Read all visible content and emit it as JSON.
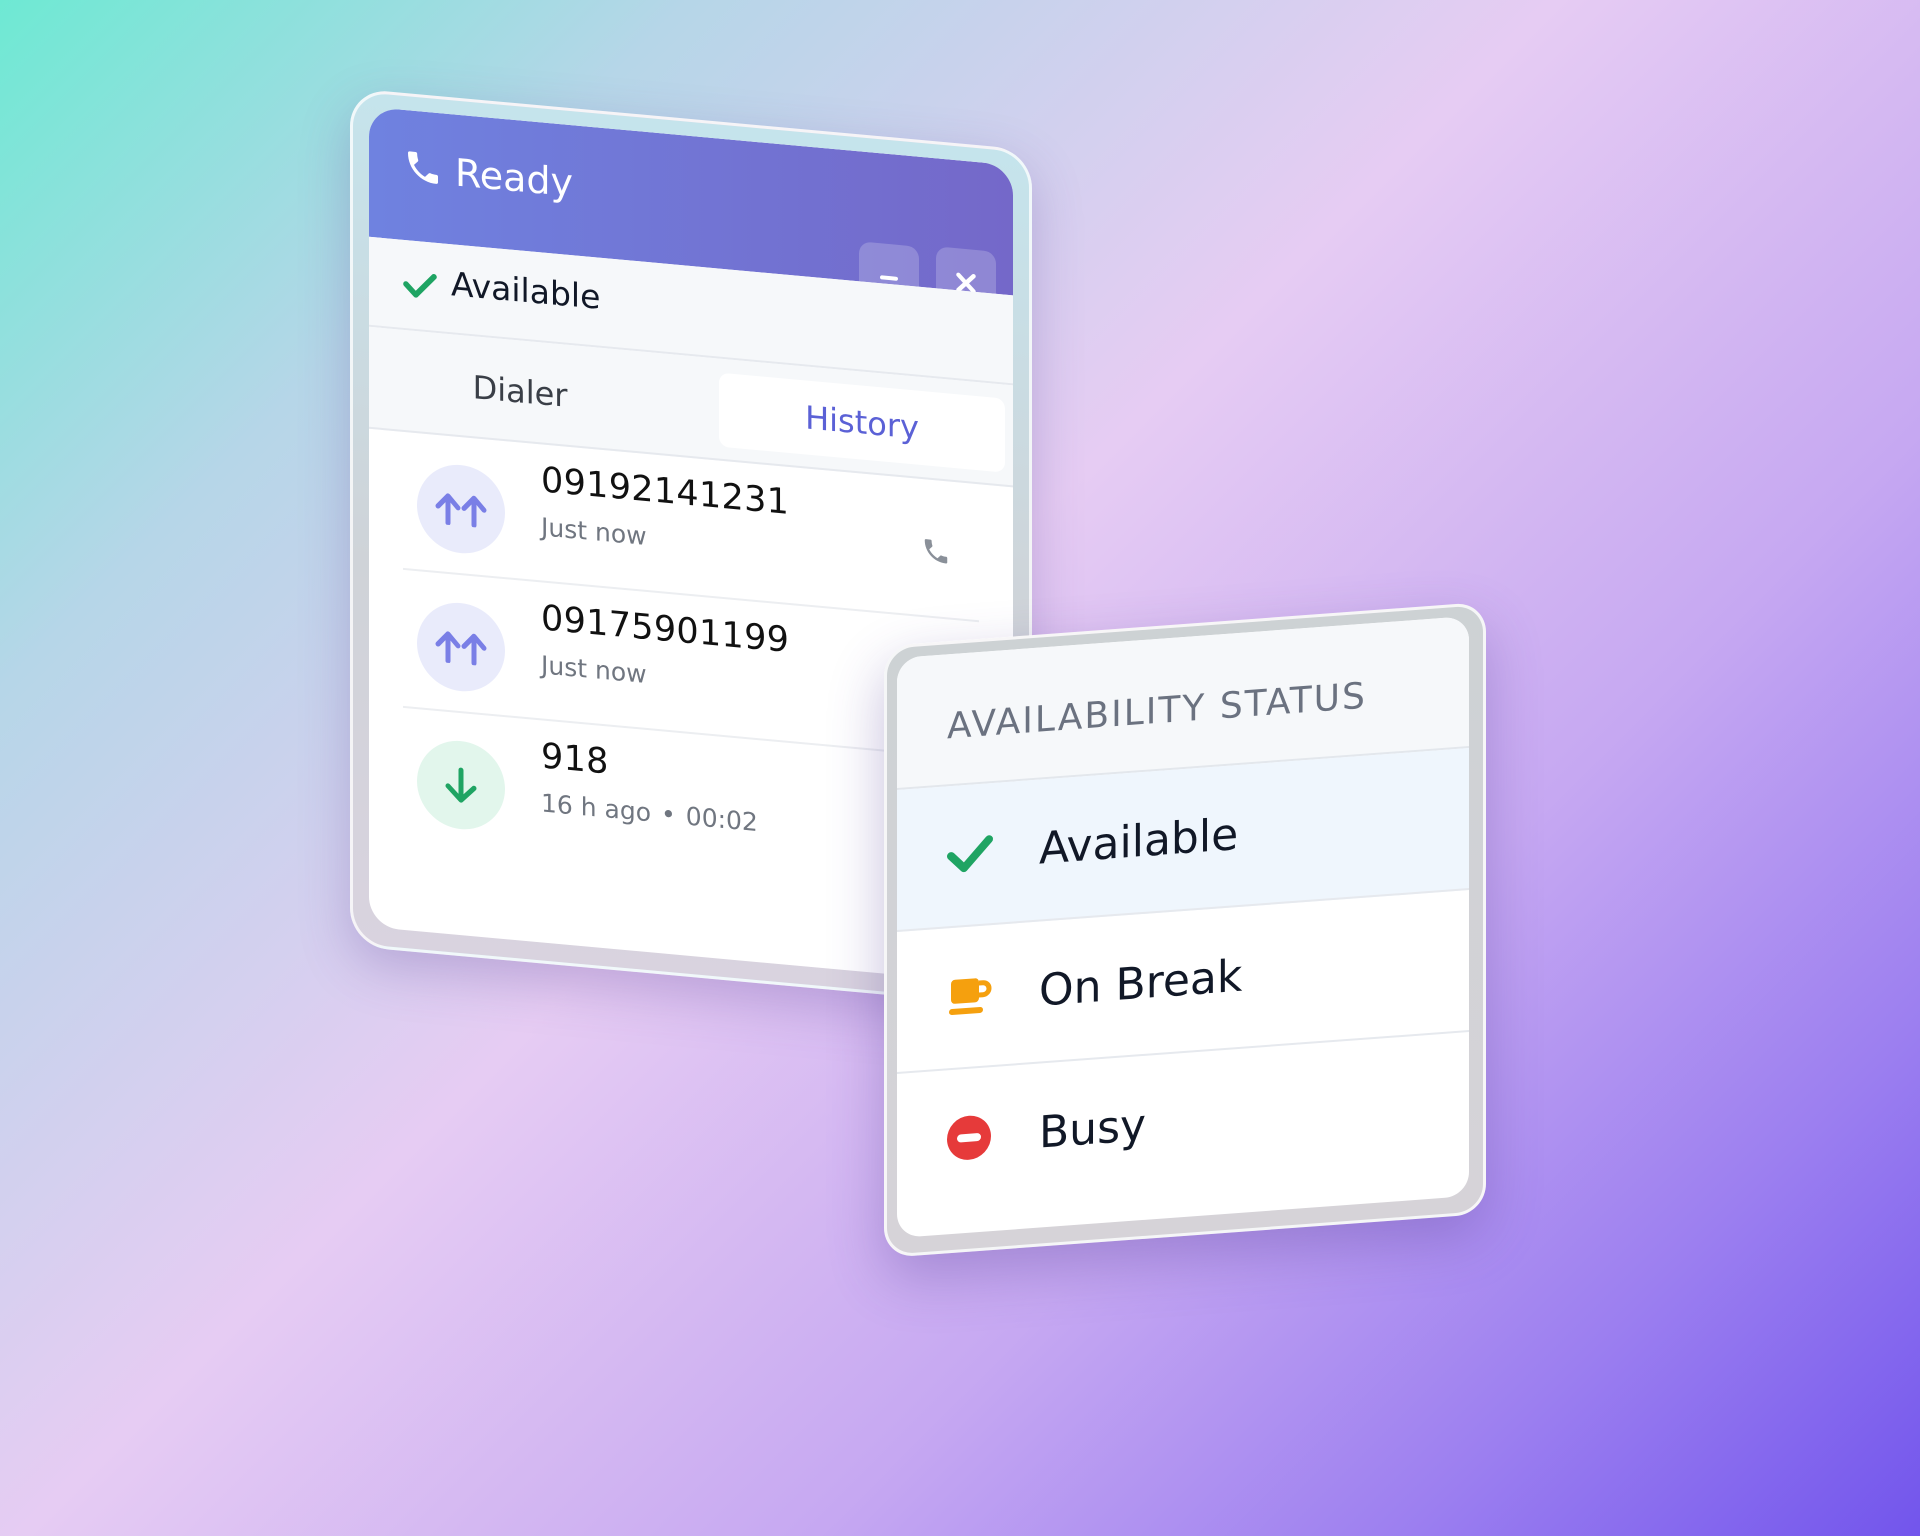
{
  "dialer": {
    "title": "Ready",
    "status_label": "Available",
    "tabs": [
      {
        "label": "Dialer",
        "active": false
      },
      {
        "label": "History",
        "active": true
      }
    ],
    "history": [
      {
        "number": "09192141231",
        "time": "Just now",
        "duration": "",
        "direction": "outgoing",
        "avatar_icon": "double-arrow-up-icon"
      },
      {
        "number": "09175901199",
        "time": "Just now",
        "duration": "",
        "direction": "outgoing",
        "avatar_icon": "double-arrow-up-icon"
      },
      {
        "number": "918",
        "time": "16 h ago",
        "duration": "00:02",
        "direction": "incoming",
        "avatar_icon": "arrow-down-icon"
      }
    ]
  },
  "availability": {
    "title": "AVAILABILITY STATUS",
    "options": [
      {
        "label": "Available",
        "icon": "check-icon",
        "selected": true,
        "color": "#1fa463"
      },
      {
        "label": "On Break",
        "icon": "coffee-cup-icon",
        "selected": false,
        "color": "#f5a00e"
      },
      {
        "label": "Busy",
        "icon": "do-not-disturb-icon",
        "selected": false,
        "color": "#e63a3a"
      }
    ]
  },
  "colors": {
    "header_start": "#6f82e0",
    "header_end": "#7468c9",
    "accent": "#5b61d6",
    "outgoing_arrow": "#7a7fe6",
    "incoming_arrow": "#1fa463"
  }
}
